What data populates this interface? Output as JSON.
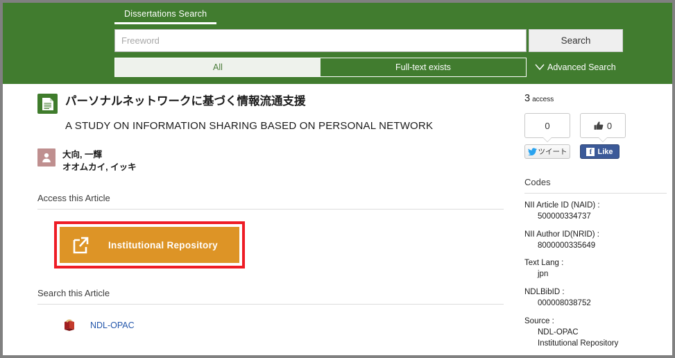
{
  "header": {
    "tab_label": "Dissertations Search",
    "search_placeholder": "Freeword",
    "search_value": "",
    "search_button": "Search",
    "filter_all": "All",
    "filter_fulltext": "Full-text exists",
    "advanced_search": "Advanced Search",
    "brand_green": "#417c2f"
  },
  "article": {
    "title_jp": "パーソナルネットワークに基づく情報流通支援",
    "title_en": "A STUDY ON INFORMATION SHARING BASED ON PERSONAL NETWORK",
    "author_kanji": "大向, 一輝",
    "author_kana": "オオムカイ, イッキ",
    "access_section_heading": "Access this Article",
    "access_button_label": "Institutional Repository",
    "access_button_color": "#dd9426",
    "highlight_color": "#ee1c25",
    "search_section_heading": "Search this Article",
    "opac_link_label": "NDL-OPAC",
    "link_color": "#2255aa"
  },
  "sidebar": {
    "access_count": "3",
    "access_label": "access",
    "tweet_count": "0",
    "tweet_label": "ツイート",
    "like_count": "0",
    "like_label": "Like",
    "codes_heading": "Codes",
    "codes": [
      {
        "label": "NII Article ID (NAID) :",
        "value": "500000334737"
      },
      {
        "label": "NII Author ID(NRID) :",
        "value": "8000000335649"
      },
      {
        "label": "Text Lang :",
        "value": "jpn"
      },
      {
        "label": "NDLBibID :",
        "value": "000008038752"
      },
      {
        "label": "Source :",
        "value": "NDL-OPAC\nInstitutional Repository"
      }
    ]
  }
}
